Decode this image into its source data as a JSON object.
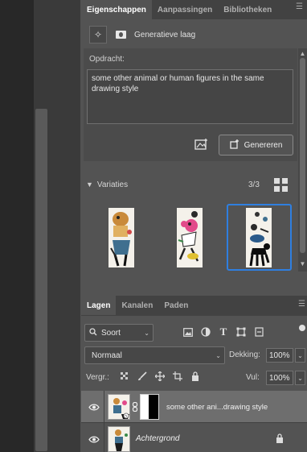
{
  "properties_panel": {
    "tabs": [
      {
        "label": "Eigenschappen",
        "active": true
      },
      {
        "label": "Aanpassingen",
        "active": false
      },
      {
        "label": "Bibliotheken",
        "active": false
      }
    ],
    "layer_type_label": "Generatieve laag",
    "prompt_label": "Opdracht:",
    "prompt_text": "some other animal or human figures in the same drawing style",
    "generate_button": "Genereren",
    "variations": {
      "label": "Variaties",
      "count": "3/3",
      "selected_index": 3
    }
  },
  "layers_panel": {
    "tabs": [
      {
        "label": "Lagen",
        "active": true
      },
      {
        "label": "Kanalen",
        "active": false
      },
      {
        "label": "Paden",
        "active": false
      }
    ],
    "filter_kind": "Soort",
    "blend_mode": "Normaal",
    "opacity_label": "Dekking:",
    "opacity_value": "100%",
    "lock_label": "Vergr.:",
    "fill_label": "Vul:",
    "fill_value": "100%",
    "layers": [
      {
        "name": "some other ani...drawing style",
        "selected": true,
        "visible": true
      },
      {
        "name": "Achtergrond",
        "selected": false,
        "visible": true,
        "locked": true
      }
    ]
  },
  "colors": {
    "panel_bg": "#535353",
    "tab_bar": "#424242",
    "selection_accent": "#2f7fe0",
    "selected_layer": "#6e6e6e"
  }
}
